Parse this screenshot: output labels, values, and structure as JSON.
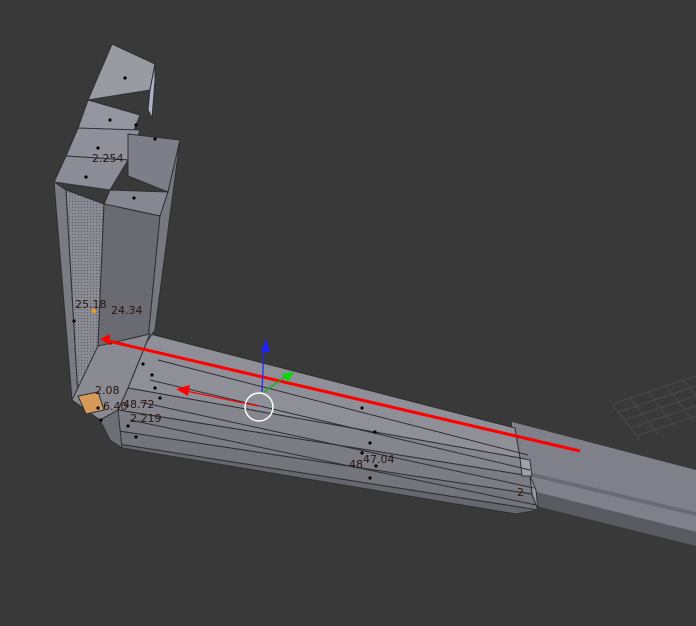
{
  "viewport": {
    "background_color": "#393939",
    "mesh_color": "#8f8f96",
    "edit_line_color": "#ff0000",
    "gizmo_x_color": "#ff0000",
    "gizmo_y_color": "#00cc00",
    "gizmo_z_color": "#0000ff",
    "measurements": {
      "edge_a": "2.254",
      "edge_b": "25.18",
      "edge_c": "24.34",
      "edge_d": "2.08",
      "edge_e": "6.40",
      "edge_f": "48.72",
      "edge_g": "2.219",
      "edge_h": "48",
      "edge_i": "47.04",
      "edge_j": "2"
    }
  }
}
